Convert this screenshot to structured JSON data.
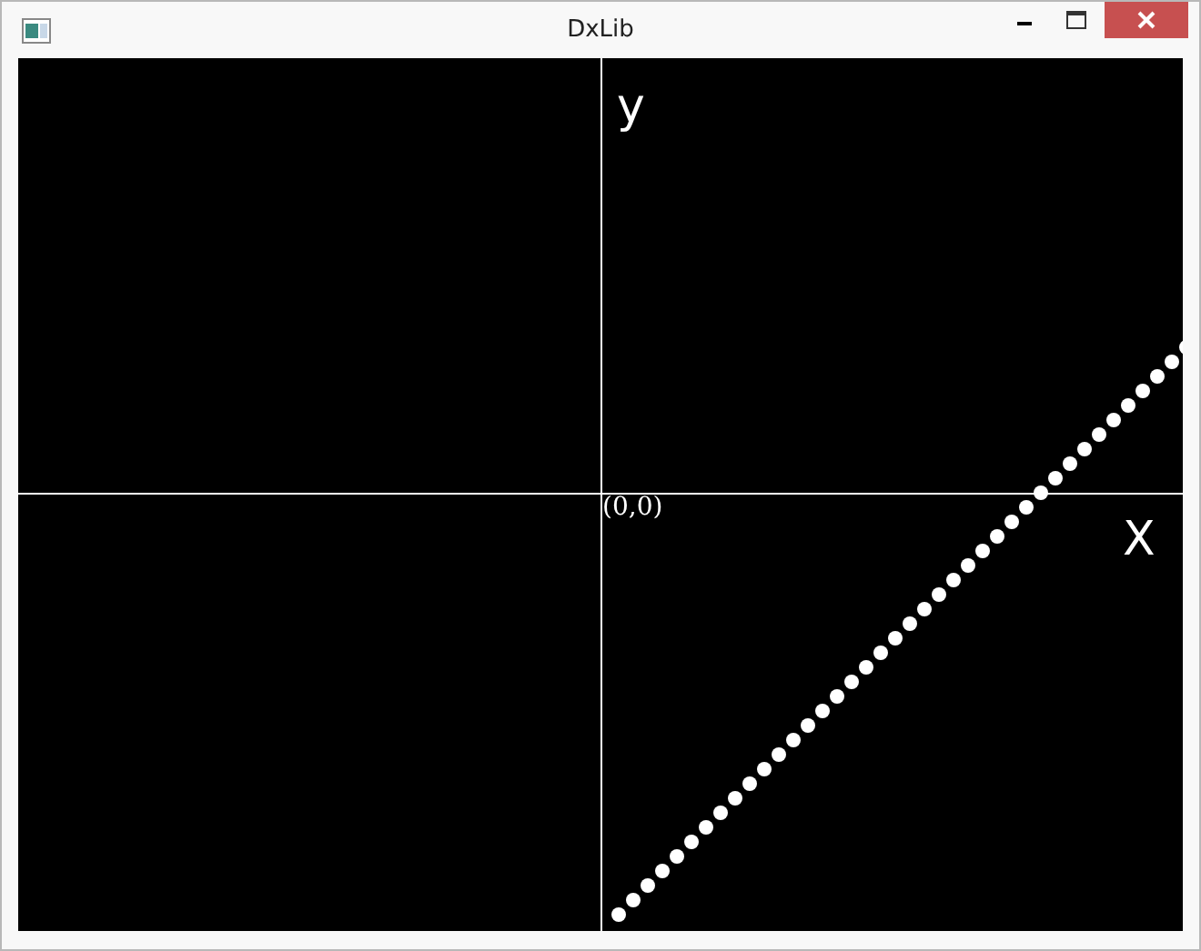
{
  "window": {
    "title": "DxLib"
  },
  "canvas": {
    "y_axis_label": "y",
    "x_axis_label": "X",
    "origin_label": "(0,0)"
  }
}
